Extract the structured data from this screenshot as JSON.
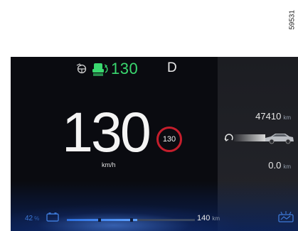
{
  "figure": {
    "id": "59531"
  },
  "header": {
    "driver_assist_icon": "hands-on-steering-icon",
    "cruise_icon": "adaptive-cruise-icon",
    "cruise_speed": "130",
    "gear": "D",
    "accent_color": "#3ad86f"
  },
  "speedometer": {
    "speed": "130",
    "unit": "km/h"
  },
  "speed_limit": {
    "value": "130",
    "color": "#c51e2c"
  },
  "trip_panel": {
    "odometer": "47410",
    "odometer_unit": "km",
    "trip": "0.0",
    "trip_unit": "km",
    "reset_icon": "trip-reset-icon",
    "car_icon": "car-icon"
  },
  "footer": {
    "battery_percent": "42",
    "battery_unit": "%",
    "battery_icon": "battery-icon",
    "range_fraction": 0.55,
    "range": "140",
    "range_unit": "km",
    "eco_icon": "eco-mode-icon",
    "accent_color": "#3d79d8"
  }
}
